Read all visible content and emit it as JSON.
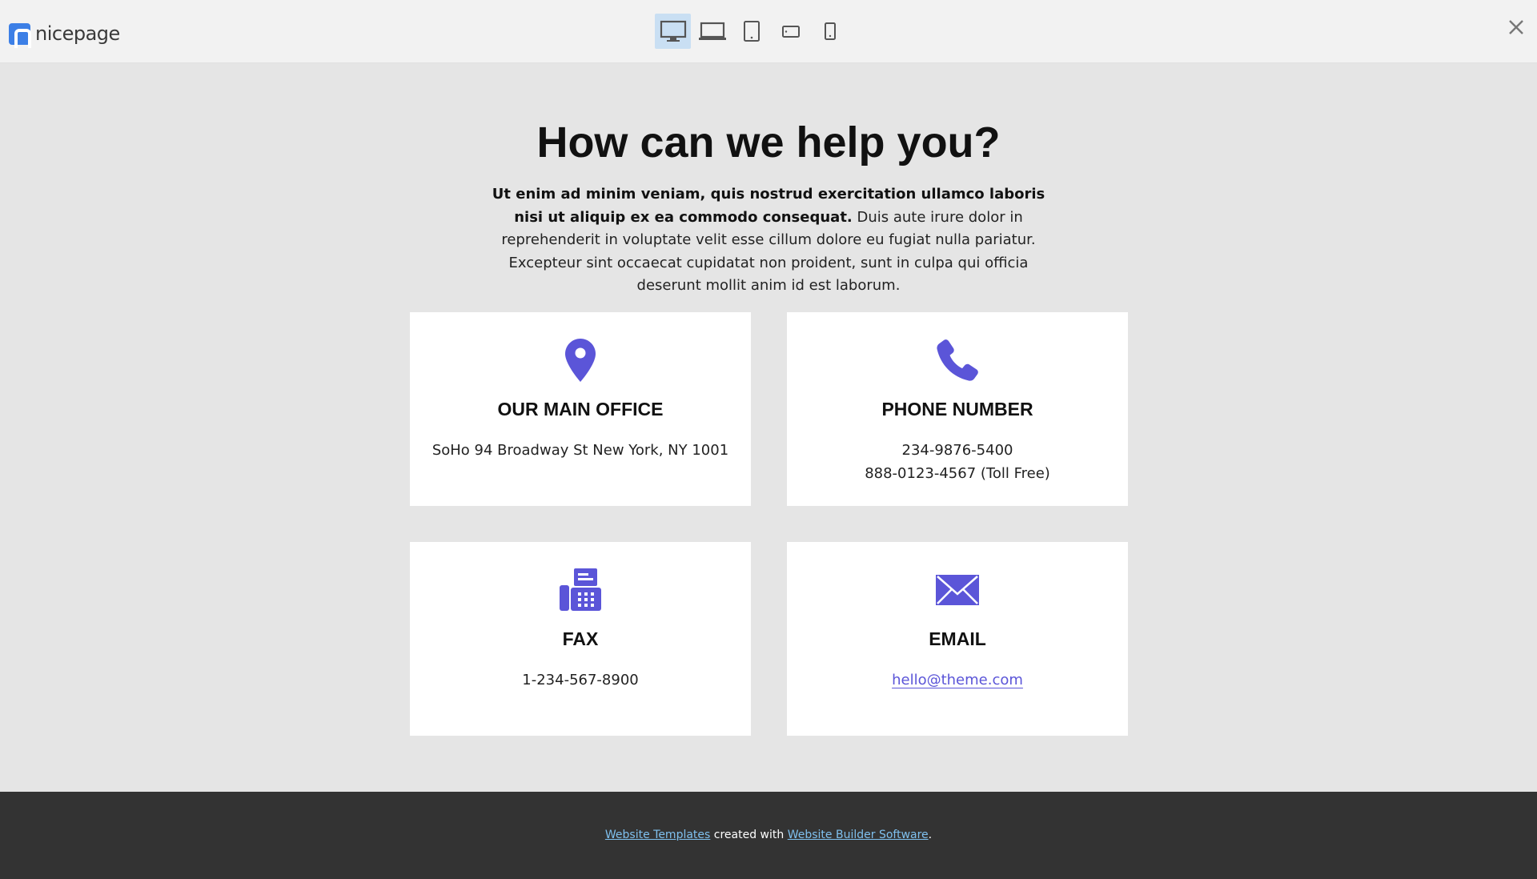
{
  "topbar": {
    "logo_text": "nicepage",
    "devices": [
      {
        "name": "desktop",
        "icon": "desktop-icon",
        "active": true
      },
      {
        "name": "laptop",
        "icon": "laptop-icon",
        "active": false
      },
      {
        "name": "tablet",
        "icon": "tablet-icon",
        "active": false
      },
      {
        "name": "phone-landscape",
        "icon": "phone-landscape-icon",
        "active": false
      },
      {
        "name": "phone-portrait",
        "icon": "phone-portrait-icon",
        "active": false
      }
    ],
    "close_icon": "close-icon",
    "active_color": "#c9dff3"
  },
  "page": {
    "title": "How can we help you?",
    "intro_bold": "Ut enim ad minim veniam, quis nostrud exercitation ullamco laboris nisi ut aliquip ex ea commodo consequat.",
    "intro_rest": " Duis aute irure dolor in reprehenderit in voluptate velit esse cillum dolore eu fugiat nulla pariatur. Excepteur sint occaecat cupidatat non proident, sunt in culpa qui officia deserunt mollit anim id est laborum.",
    "accent_color": "#5b55d8",
    "cards": [
      {
        "icon": "location-pin-icon",
        "title": "OUR MAIN OFFICE",
        "line1": "SoHo 94 Broadway St New York, NY 1001"
      },
      {
        "icon": "phone-icon",
        "title": "PHONE NUMBER",
        "line1": "234-9876-5400",
        "line2": "888-0123-4567 (Toll Free)"
      },
      {
        "icon": "fax-icon",
        "title": "FAX",
        "line1": "1-234-567-8900"
      },
      {
        "icon": "envelope-icon",
        "title": "EMAIL",
        "line1": "hello@theme.com"
      }
    ]
  },
  "footer": {
    "link1": "Website Templates",
    "middle": " created with ",
    "link2": "Website Builder Software",
    "end": "."
  }
}
